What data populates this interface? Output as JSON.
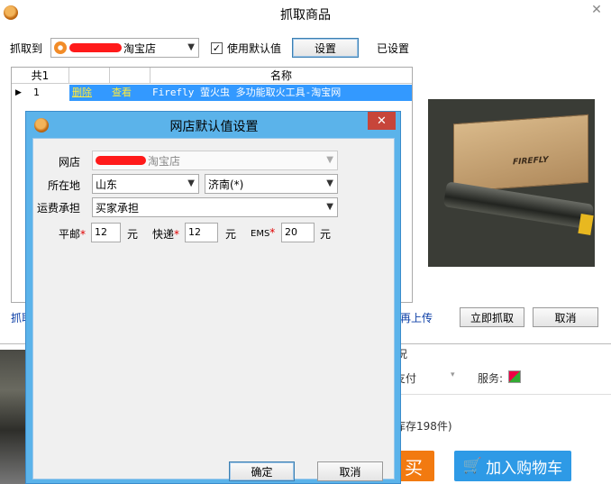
{
  "main_window": {
    "title": "抓取商品",
    "close_glyph": "✕",
    "grab_to_label": "抓取到",
    "shop_name": "淘宝店",
    "use_default_label": "使用默认值",
    "use_default_checked": true,
    "settings_button": "设置",
    "already_set_label": "已设置",
    "table": {
      "columns": [
        "共1",
        "",
        "",
        "名称"
      ],
      "rows": [
        {
          "index": "1",
          "delete": "删除",
          "view": "查看",
          "name": "Firefly 萤火虫 多功能取火工具-淘宝网"
        }
      ]
    },
    "grab_link_partial": "抓取",
    "reupload_link_partial": "再上传",
    "grab_now_button": "立即抓取",
    "cancel_button": "取消"
  },
  "background_page": {
    "text_partial_1": "况",
    "pay_partial": "支付",
    "service_label": "服务:",
    "stock_partial": "库存198件)",
    "buy_partial": "买",
    "add_to_cart": "加入购物车"
  },
  "dialog": {
    "title": "网店默认值设置",
    "close_glyph": "✕",
    "shop_label": "网店",
    "shop_value": "淘宝店",
    "location_label": "所在地",
    "province": "山东",
    "city": "济南(*)",
    "shipping_label": "运费承担",
    "shipping_value": "买家承担",
    "post_label": "平邮",
    "post_value": "12",
    "express_label": "快递",
    "express_value": "12",
    "ems_label": "EMS",
    "ems_value": "20",
    "unit": "元",
    "required_mark": "*",
    "ok_button": "确定",
    "cancel_button": "取消"
  },
  "colors": {
    "dialog_frame": "#5bb3ea",
    "dialog_close": "#c7453a",
    "selection": "#3399ff",
    "buy_button": "#f27a10",
    "cart_button": "#2e9ae6"
  }
}
